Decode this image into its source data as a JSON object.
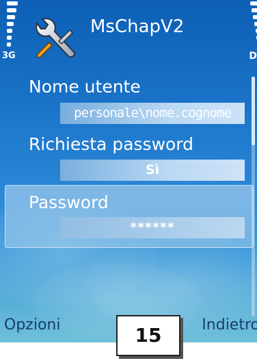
{
  "status": {
    "network": "3G",
    "battery_label": "D"
  },
  "header": {
    "title": "MsChapV2",
    "app_icon": "tools-wrench-screwdriver-icon"
  },
  "fields": [
    {
      "label": "Nome utente",
      "value": "personale\\nome.cognome"
    },
    {
      "label": "Richiesta password",
      "value": "Sì"
    },
    {
      "label": "Password",
      "value": "******"
    }
  ],
  "softkeys": {
    "left": "Opzioni",
    "right": "Indietro"
  },
  "page_badge": "15",
  "colors": {
    "background": "#1a73c8",
    "softkey_text": "#1a3d6e",
    "field_text": "#ffffff"
  }
}
